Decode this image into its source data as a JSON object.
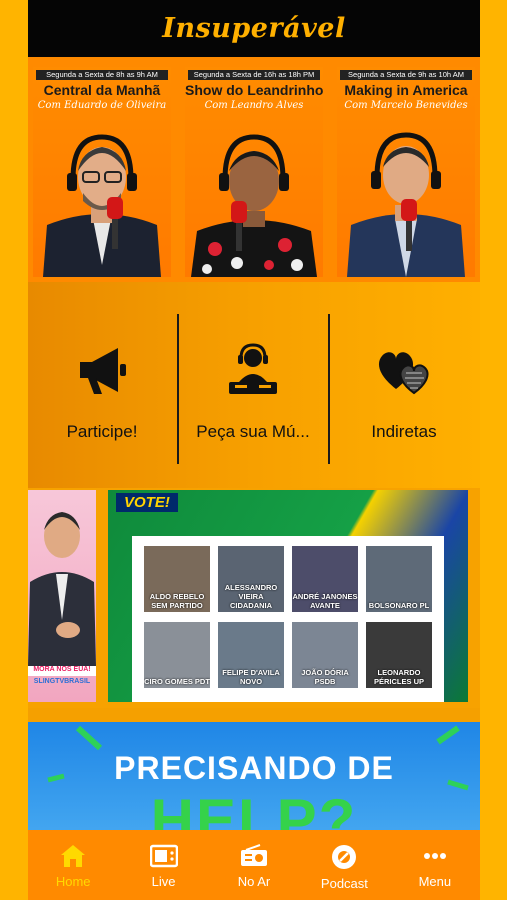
{
  "header": {
    "title": "Insuperável"
  },
  "shows": [
    {
      "schedule": "Segunda a Sexta de 8h as 9h AM",
      "title": "Central da Manhã",
      "host": "Com Eduardo de Oliveira"
    },
    {
      "schedule": "Segunda a Sexta de 16h as 18h PM",
      "title": "Show do Leandrinho",
      "host": "Com Leandro Alves"
    },
    {
      "schedule": "Segunda a Sexta de 9h as 10h AM",
      "title": "Making in America",
      "host": "Com Marcelo Benevides"
    }
  ],
  "actions": [
    {
      "label": "Participe!",
      "icon": "megaphone-icon"
    },
    {
      "label": "Peça sua Mú...",
      "icon": "dj-icon"
    },
    {
      "label": "Indiretas",
      "icon": "hearts-icon"
    }
  ],
  "banners": {
    "left_caption": "MORA NOS EUA!",
    "left_sub": "SLINGTVBRASIL",
    "vote_tag": "VOTE!",
    "candidates": [
      "ALDO REBELO SEM PARTIDO",
      "ALESSANDRO VIEIRA CIDADANIA",
      "ANDRÉ JANONES AVANTE",
      "BOLSONARO PL",
      "CIRO GOMES PDT",
      "FELIPE D'AVILA NOVO",
      "JOÃO DÓRIA PSDB",
      "LEONARDO PÉRICLES UP"
    ]
  },
  "promo": {
    "line1": "PRECISANDO DE",
    "line2": "HELP?"
  },
  "tabs": [
    {
      "label": "Home",
      "icon": "home-icon",
      "active": true
    },
    {
      "label": "Live",
      "icon": "tv-icon",
      "active": false
    },
    {
      "label": "No Ar",
      "icon": "radio-icon",
      "active": false
    },
    {
      "label": "Podcast",
      "icon": "podcast-icon",
      "active": false
    },
    {
      "label": "Menu",
      "icon": "more-icon",
      "active": false
    }
  ],
  "colors": {
    "accent": "#ff8a00",
    "brand": "#ffb000",
    "active_tab": "#ffd900"
  }
}
